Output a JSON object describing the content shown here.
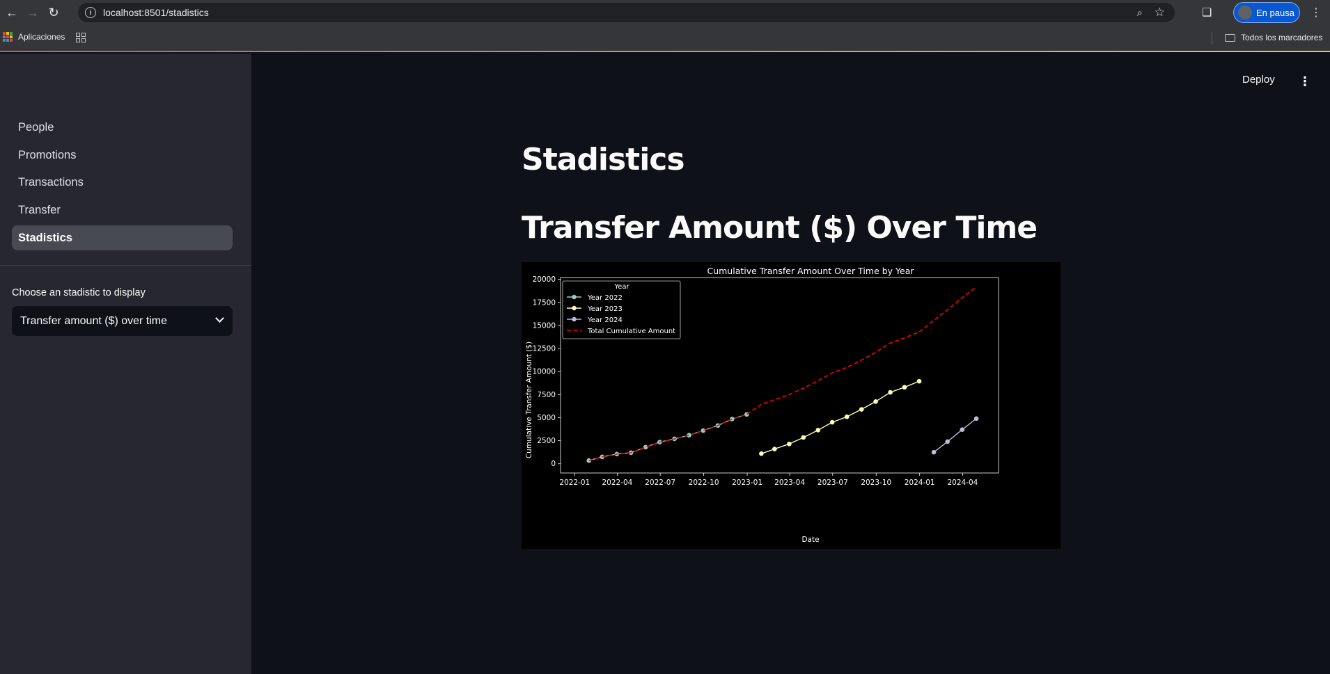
{
  "browser": {
    "url": "localhost:8501/stadistics",
    "profile_label": "En pausa",
    "bookmarks_apps": "Aplicaciones",
    "bookmarks_all": "Todos los marcadores"
  },
  "header": {
    "deploy_label": "Deploy"
  },
  "sidebar": {
    "items": [
      {
        "label": "People"
      },
      {
        "label": "Promotions"
      },
      {
        "label": "Transactions"
      },
      {
        "label": "Transfer"
      },
      {
        "label": "Stadistics",
        "active": true
      }
    ],
    "select_label": "Choose an stadistic to display",
    "select_value": "Transfer amount ($) over time"
  },
  "main": {
    "title": "Stadistics",
    "subtitle": "Transfer Amount ($) Over Time"
  },
  "colors": {
    "year_2022": "#8dd3c7",
    "year_2023": "#feffb3",
    "year_2024": "#bfbbd9",
    "total": "#ff0000",
    "accent": "#ff4b4b"
  },
  "chart_data": {
    "type": "line",
    "title": "Cumulative Transfer Amount Over Time by Year",
    "xlabel": "Date",
    "ylabel": "Cumulative Transfer Amount ($)",
    "xlim": [
      "2021-12-02",
      "2024-06-16"
    ],
    "ylim": [
      -1000,
      20200
    ],
    "x_ticks": [
      "2022-01",
      "2022-04",
      "2022-07",
      "2022-10",
      "2023-01",
      "2023-04",
      "2023-07",
      "2023-10",
      "2024-01",
      "2024-04"
    ],
    "y_ticks": [
      0,
      2500,
      5000,
      7500,
      10000,
      12500,
      15000,
      17500,
      20000
    ],
    "legend": {
      "title": "Year",
      "position": "top-left"
    },
    "series": [
      {
        "name": "Year 2022",
        "style": "marker-line",
        "x": [
          "2022-01-31",
          "2022-02-28",
          "2022-03-31",
          "2022-04-30",
          "2022-05-31",
          "2022-06-30",
          "2022-07-31",
          "2022-08-31",
          "2022-09-30",
          "2022-10-31",
          "2022-11-30",
          "2022-12-31"
        ],
        "y": [
          350,
          750,
          1050,
          1200,
          1800,
          2350,
          2700,
          3100,
          3600,
          4150,
          4850,
          5350
        ]
      },
      {
        "name": "Year 2023",
        "style": "marker-line",
        "x": [
          "2023-01-31",
          "2023-02-28",
          "2023-03-31",
          "2023-04-30",
          "2023-05-31",
          "2023-06-30",
          "2023-07-31",
          "2023-08-31",
          "2023-09-30",
          "2023-10-31",
          "2023-11-30",
          "2023-12-31"
        ],
        "y": [
          1100,
          1600,
          2150,
          2850,
          3650,
          4500,
          5100,
          5900,
          6750,
          7750,
          8300,
          8950
        ]
      },
      {
        "name": "Year 2024",
        "style": "marker-line",
        "x": [
          "2024-01-31",
          "2024-02-29",
          "2024-03-31",
          "2024-04-30"
        ],
        "y": [
          1250,
          2400,
          3700,
          4900
        ]
      },
      {
        "name": "Total Cumulative Amount",
        "style": "dashed",
        "x": [
          "2022-01-31",
          "2022-02-28",
          "2022-03-31",
          "2022-04-30",
          "2022-05-31",
          "2022-06-30",
          "2022-07-31",
          "2022-08-31",
          "2022-09-30",
          "2022-10-31",
          "2022-11-30",
          "2022-12-31",
          "2023-01-31",
          "2023-02-28",
          "2023-03-31",
          "2023-04-30",
          "2023-05-31",
          "2023-06-30",
          "2023-07-31",
          "2023-08-31",
          "2023-09-30",
          "2023-10-31",
          "2023-11-30",
          "2023-12-31",
          "2024-01-31",
          "2024-02-29",
          "2024-03-31",
          "2024-04-30"
        ],
        "y": [
          350,
          750,
          1050,
          1200,
          1800,
          2350,
          2700,
          3100,
          3600,
          4150,
          4850,
          5350,
          6450,
          6950,
          7500,
          8200,
          9000,
          9850,
          10450,
          11250,
          12100,
          13100,
          13650,
          14300,
          15550,
          16700,
          18000,
          19200
        ]
      }
    ]
  }
}
